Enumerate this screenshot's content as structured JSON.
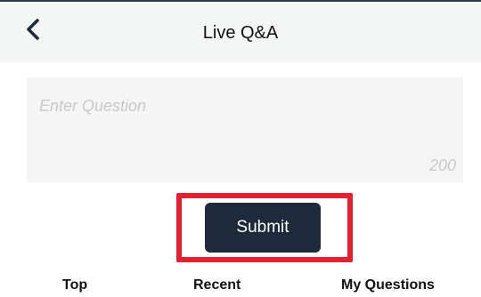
{
  "header": {
    "title": "Live Q&A",
    "back_icon": "chevron-left-icon"
  },
  "question_input": {
    "placeholder": "Enter Question",
    "value": "",
    "char_limit": "200"
  },
  "submit": {
    "label": "Submit",
    "highlight_color": "#e6202f",
    "button_color": "#1e2a3b"
  },
  "tabs": [
    {
      "label": "Top"
    },
    {
      "label": "Recent"
    },
    {
      "label": "My Questions"
    }
  ]
}
